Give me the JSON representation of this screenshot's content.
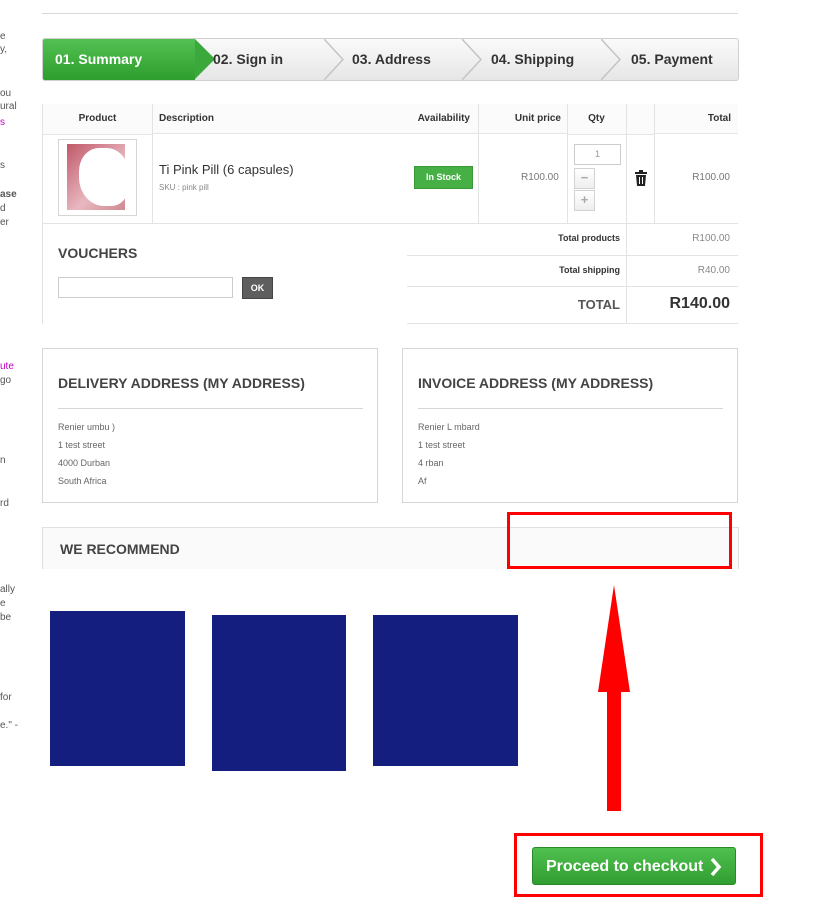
{
  "left_column": {
    "fragments": [
      "e",
      "y,",
      "ou",
      "ural",
      "s",
      "s",
      "ase",
      "d",
      "er",
      "ute",
      "go",
      "n",
      "rd",
      "ally",
      "e",
      "be",
      "for",
      "e.\" -"
    ]
  },
  "steps": [
    {
      "label": "01. Summary",
      "active": true
    },
    {
      "label": "02. Sign in"
    },
    {
      "label": "03. Address"
    },
    {
      "label": "04. Shipping"
    },
    {
      "label": "05. Payment"
    }
  ],
  "cart": {
    "headers": {
      "product": "Product",
      "description": "Description",
      "availability": "Availability",
      "unit_price": "Unit price",
      "qty": "Qty",
      "total": "Total"
    },
    "item": {
      "name": "Ti   Pink Pill (6 capsules)",
      "sku": "SKU : pink pill",
      "availability": "In Stock",
      "unit_price": "R100.00",
      "qty": "1",
      "total": "R100.00"
    },
    "vouchers_title": "VOUCHERS",
    "ok_label": "OK",
    "summary": {
      "total_products_label": "Total products",
      "total_products_value": "R100.00",
      "total_shipping_label": "Total shipping",
      "total_shipping_value": "R40.00",
      "total_label": "TOTAL",
      "total_value": "R140.00"
    }
  },
  "delivery": {
    "title": "DELIVERY ADDRESS (MY ADDRESS)",
    "lines": [
      "Renier  umbu  )",
      "1 test street",
      "4000 Durban",
      "South Africa"
    ]
  },
  "invoice": {
    "title": "INVOICE ADDRESS (MY ADDRESS)",
    "lines": [
      "Renier L mbard",
      "1 test street",
      "4        rban",
      "        Af"
    ]
  },
  "recommend": {
    "title": "WE RECOMMEND"
  },
  "checkout": {
    "label": "Proceed to checkout"
  },
  "colors": {
    "accent_green": "#3aa83a",
    "annotation_red": "#ff0000",
    "tile_blue": "#141e7e"
  }
}
